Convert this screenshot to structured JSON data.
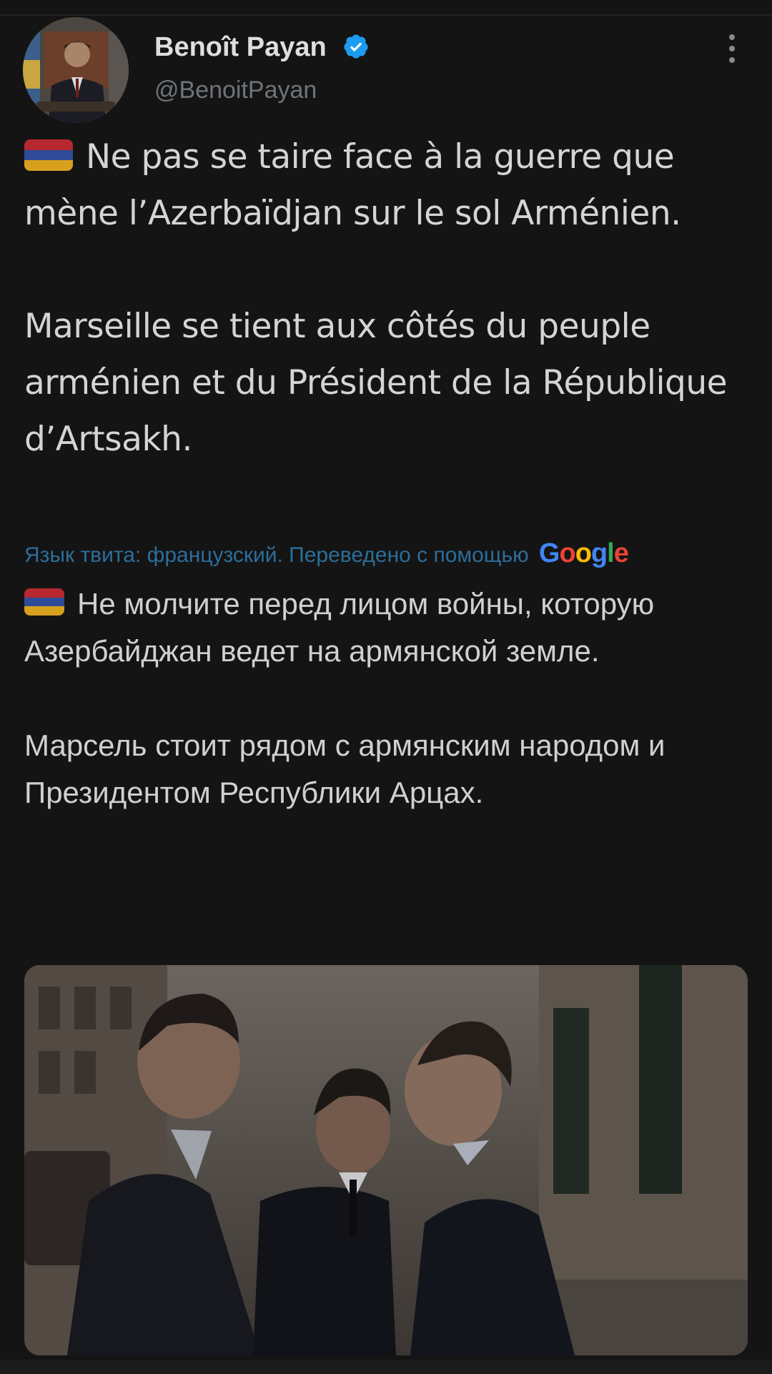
{
  "tweet": {
    "author": {
      "display_name": "Benoît Payan",
      "handle": "@BenoitPayan",
      "verified": true
    },
    "text_fr": {
      "paragraph_1": "Ne pas se taire face à la guerre que mène l’Azerbaïdjan sur le sol Arménien.",
      "paragraph_2": "Marseille se tient aux côtés du peuple arménien et du Président de la République d’Artsakh."
    },
    "translation_note": "Язык твита: французский. Переведено с помощью",
    "translation_provider": "Google",
    "text_ru": {
      "paragraph_1": "Не молчите перед лицом войны, которую Азербайджан ведет на армянской земле.",
      "paragraph_2": "Марсель стоит рядом с армянским народом и Президентом Республики Арцах."
    }
  },
  "icons": {
    "verified": "verified-badge-icon",
    "more": "more-options-icon",
    "flag": "armenia-flag-emoji"
  },
  "colors": {
    "background": "#141414",
    "verified_blue": "#1d9bf0",
    "link_blue": "#2c6e9a",
    "flag_red": "#b7282f",
    "flag_blue": "#2e4a99",
    "flag_orange": "#d7a11e"
  }
}
